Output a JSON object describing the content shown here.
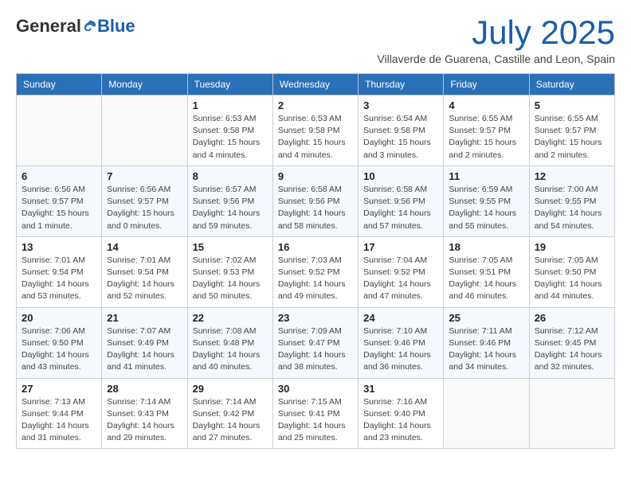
{
  "logo": {
    "general": "General",
    "blue": "Blue"
  },
  "title": {
    "month_year": "July 2025",
    "location": "Villaverde de Guarena, Castille and Leon, Spain"
  },
  "weekdays": [
    "Sunday",
    "Monday",
    "Tuesday",
    "Wednesday",
    "Thursday",
    "Friday",
    "Saturday"
  ],
  "weeks": [
    [
      {
        "day": "",
        "info": ""
      },
      {
        "day": "",
        "info": ""
      },
      {
        "day": "1",
        "info": "Sunrise: 6:53 AM\nSunset: 9:58 PM\nDaylight: 15 hours\nand 4 minutes."
      },
      {
        "day": "2",
        "info": "Sunrise: 6:53 AM\nSunset: 9:58 PM\nDaylight: 15 hours\nand 4 minutes."
      },
      {
        "day": "3",
        "info": "Sunrise: 6:54 AM\nSunset: 9:58 PM\nDaylight: 15 hours\nand 3 minutes."
      },
      {
        "day": "4",
        "info": "Sunrise: 6:55 AM\nSunset: 9:57 PM\nDaylight: 15 hours\nand 2 minutes."
      },
      {
        "day": "5",
        "info": "Sunrise: 6:55 AM\nSunset: 9:57 PM\nDaylight: 15 hours\nand 2 minutes."
      }
    ],
    [
      {
        "day": "6",
        "info": "Sunrise: 6:56 AM\nSunset: 9:57 PM\nDaylight: 15 hours\nand 1 minute."
      },
      {
        "day": "7",
        "info": "Sunrise: 6:56 AM\nSunset: 9:57 PM\nDaylight: 15 hours\nand 0 minutes."
      },
      {
        "day": "8",
        "info": "Sunrise: 6:57 AM\nSunset: 9:56 PM\nDaylight: 14 hours\nand 59 minutes."
      },
      {
        "day": "9",
        "info": "Sunrise: 6:58 AM\nSunset: 9:56 PM\nDaylight: 14 hours\nand 58 minutes."
      },
      {
        "day": "10",
        "info": "Sunrise: 6:58 AM\nSunset: 9:56 PM\nDaylight: 14 hours\nand 57 minutes."
      },
      {
        "day": "11",
        "info": "Sunrise: 6:59 AM\nSunset: 9:55 PM\nDaylight: 14 hours\nand 55 minutes."
      },
      {
        "day": "12",
        "info": "Sunrise: 7:00 AM\nSunset: 9:55 PM\nDaylight: 14 hours\nand 54 minutes."
      }
    ],
    [
      {
        "day": "13",
        "info": "Sunrise: 7:01 AM\nSunset: 9:54 PM\nDaylight: 14 hours\nand 53 minutes."
      },
      {
        "day": "14",
        "info": "Sunrise: 7:01 AM\nSunset: 9:54 PM\nDaylight: 14 hours\nand 52 minutes."
      },
      {
        "day": "15",
        "info": "Sunrise: 7:02 AM\nSunset: 9:53 PM\nDaylight: 14 hours\nand 50 minutes."
      },
      {
        "day": "16",
        "info": "Sunrise: 7:03 AM\nSunset: 9:52 PM\nDaylight: 14 hours\nand 49 minutes."
      },
      {
        "day": "17",
        "info": "Sunrise: 7:04 AM\nSunset: 9:52 PM\nDaylight: 14 hours\nand 47 minutes."
      },
      {
        "day": "18",
        "info": "Sunrise: 7:05 AM\nSunset: 9:51 PM\nDaylight: 14 hours\nand 46 minutes."
      },
      {
        "day": "19",
        "info": "Sunrise: 7:05 AM\nSunset: 9:50 PM\nDaylight: 14 hours\nand 44 minutes."
      }
    ],
    [
      {
        "day": "20",
        "info": "Sunrise: 7:06 AM\nSunset: 9:50 PM\nDaylight: 14 hours\nand 43 minutes."
      },
      {
        "day": "21",
        "info": "Sunrise: 7:07 AM\nSunset: 9:49 PM\nDaylight: 14 hours\nand 41 minutes."
      },
      {
        "day": "22",
        "info": "Sunrise: 7:08 AM\nSunset: 9:48 PM\nDaylight: 14 hours\nand 40 minutes."
      },
      {
        "day": "23",
        "info": "Sunrise: 7:09 AM\nSunset: 9:47 PM\nDaylight: 14 hours\nand 38 minutes."
      },
      {
        "day": "24",
        "info": "Sunrise: 7:10 AM\nSunset: 9:46 PM\nDaylight: 14 hours\nand 36 minutes."
      },
      {
        "day": "25",
        "info": "Sunrise: 7:11 AM\nSunset: 9:46 PM\nDaylight: 14 hours\nand 34 minutes."
      },
      {
        "day": "26",
        "info": "Sunrise: 7:12 AM\nSunset: 9:45 PM\nDaylight: 14 hours\nand 32 minutes."
      }
    ],
    [
      {
        "day": "27",
        "info": "Sunrise: 7:13 AM\nSunset: 9:44 PM\nDaylight: 14 hours\nand 31 minutes."
      },
      {
        "day": "28",
        "info": "Sunrise: 7:14 AM\nSunset: 9:43 PM\nDaylight: 14 hours\nand 29 minutes."
      },
      {
        "day": "29",
        "info": "Sunrise: 7:14 AM\nSunset: 9:42 PM\nDaylight: 14 hours\nand 27 minutes."
      },
      {
        "day": "30",
        "info": "Sunrise: 7:15 AM\nSunset: 9:41 PM\nDaylight: 14 hours\nand 25 minutes."
      },
      {
        "day": "31",
        "info": "Sunrise: 7:16 AM\nSunset: 9:40 PM\nDaylight: 14 hours\nand 23 minutes."
      },
      {
        "day": "",
        "info": ""
      },
      {
        "day": "",
        "info": ""
      }
    ]
  ]
}
